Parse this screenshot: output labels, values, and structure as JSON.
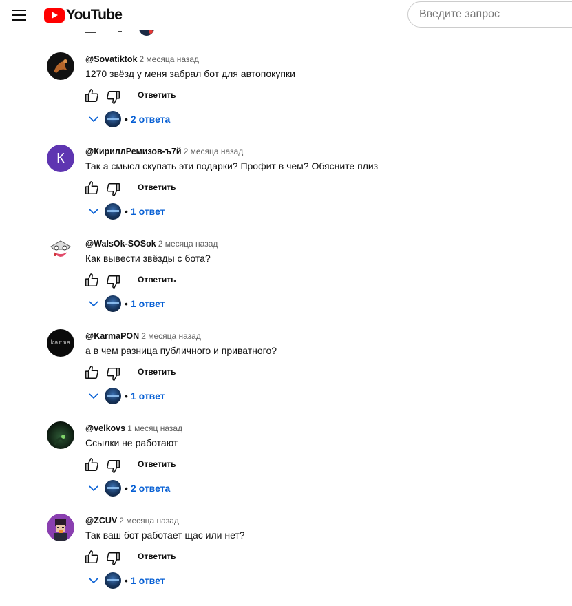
{
  "header": {
    "logo_text": "YouTube",
    "search_placeholder": "Введите запрос"
  },
  "reply_label": "Ответить",
  "comments": [
    {
      "author": "@Sovatiktok",
      "time": "2 месяца назад",
      "text": "1270 звёзд у меня забрал бот для автопокупки",
      "replies": "2 ответа",
      "avatar_color": "#1a1a1a"
    },
    {
      "author": "@КириллРемизов-ъ7й",
      "time": "2 месяца назад",
      "text": "Так а смысл скупать эти подарки? Профит в чем? Обясните плиз",
      "replies": "1 ответ",
      "avatar_color": "#5e35b1",
      "avatar_letter": "К"
    },
    {
      "author": "@WalsOk-SOSok",
      "time": "2 месяца назад",
      "text": "Как вывести звёзды с бота?",
      "replies": "1 ответ",
      "avatar_color": "#ffffff"
    },
    {
      "author": "@KarmaPON",
      "time": "2 месяца назад",
      "text": "а в чем разница публичного и приватного?",
      "replies": "1 ответ",
      "avatar_color": "#0a0a0a",
      "avatar_letter": "karma"
    },
    {
      "author": "@velkovs",
      "time": "1 месяц назад",
      "text": "Ссылки не работают",
      "replies": "2 ответа",
      "avatar_color": "#0e1f14"
    },
    {
      "author": "@ZCUV",
      "time": "2 месяца назад",
      "text": "Так ваш бот работает щас или нет?",
      "replies": "1 ответ",
      "avatar_color": "#7b3fa0"
    }
  ]
}
